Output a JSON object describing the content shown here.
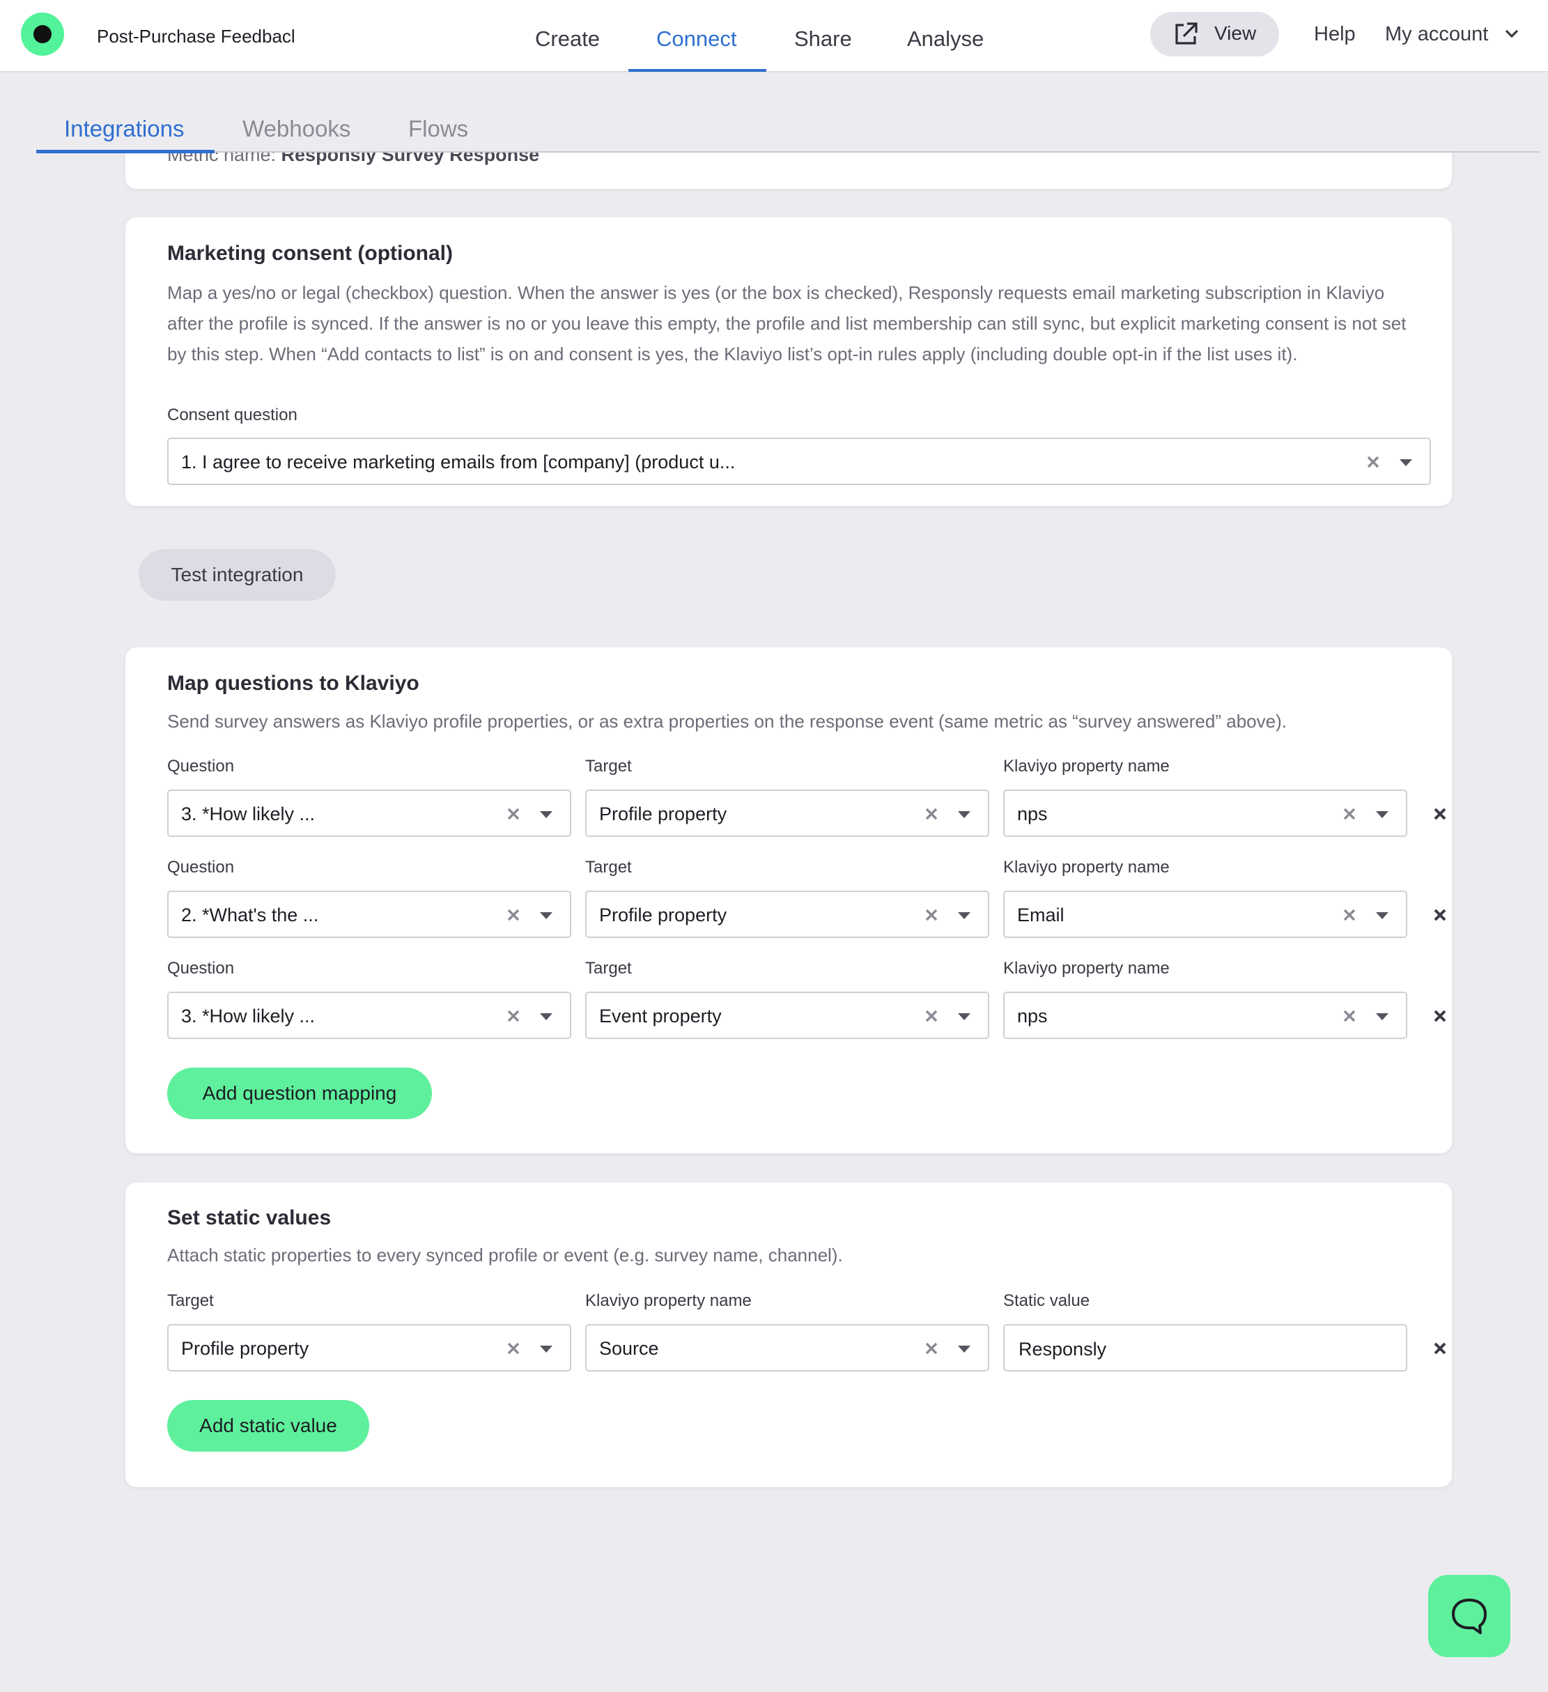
{
  "header": {
    "survey_title": "Post-Purchase Feedbacl",
    "nav": [
      "Create",
      "Connect",
      "Share",
      "Analyse"
    ],
    "active_nav": "Connect",
    "view_label": "View",
    "help_label": "Help",
    "account_label": "My account"
  },
  "subtabs": [
    "Integrations",
    "Webhooks",
    "Flows"
  ],
  "metric": {
    "prefix": "Metric name: ",
    "name": "Responsly Survey Response"
  },
  "consent": {
    "title": "Marketing consent (optional)",
    "description": "Map a yes/no or legal (checkbox) question. When the answer is yes (or the box is checked), Responsly requests email marketing subscription in Klaviyo after the profile is synced. If the answer is no or you leave this empty, the profile and list membership can still sync, but explicit marketing consent is not set by this step. When “Add contacts to list” is on and consent is yes, the Klaviyo list’s opt-in rules apply (including double opt-in if the list uses it).",
    "field_label": "Consent question",
    "selected": "1. I agree to receive marketing emails from [company] (product u..."
  },
  "test_button": "Test integration",
  "mapping": {
    "title": "Map questions to Klaviyo",
    "description": "Send survey answers as Klaviyo profile properties, or as extra properties on the response event (same metric as “survey answered” above).",
    "col_question": "Question",
    "col_target": "Target",
    "col_property": "Klaviyo property name",
    "rows": [
      {
        "question": "3. *How likely ...",
        "target": "Profile property",
        "property": "nps"
      },
      {
        "question": "2. *What's the ...",
        "target": "Profile property",
        "property": "Email"
      },
      {
        "question": "3. *How likely ...",
        "target": "Event property",
        "property": "nps"
      }
    ],
    "add_button": "Add question mapping"
  },
  "static": {
    "title": "Set static values",
    "description": "Attach static properties to every synced profile or event (e.g. survey name, channel).",
    "col_target": "Target",
    "col_property": "Klaviyo property name",
    "col_value": "Static value",
    "row": {
      "target": "Profile property",
      "property": "Source",
      "value": "Responsly"
    },
    "add_button": "Add static value"
  },
  "colors": {
    "accent": "#2f6fce",
    "brand_green": "#5ef09c",
    "background": "#ececf0"
  },
  "icons": {
    "logo": "brand-logo-icon",
    "view": "external-link-icon",
    "account": "chevron-down-icon",
    "clear": "clear-icon",
    "dropdown": "dropdown-arrow-icon",
    "remove": "remove-row-icon",
    "chat": "chat-bubble-icon"
  }
}
